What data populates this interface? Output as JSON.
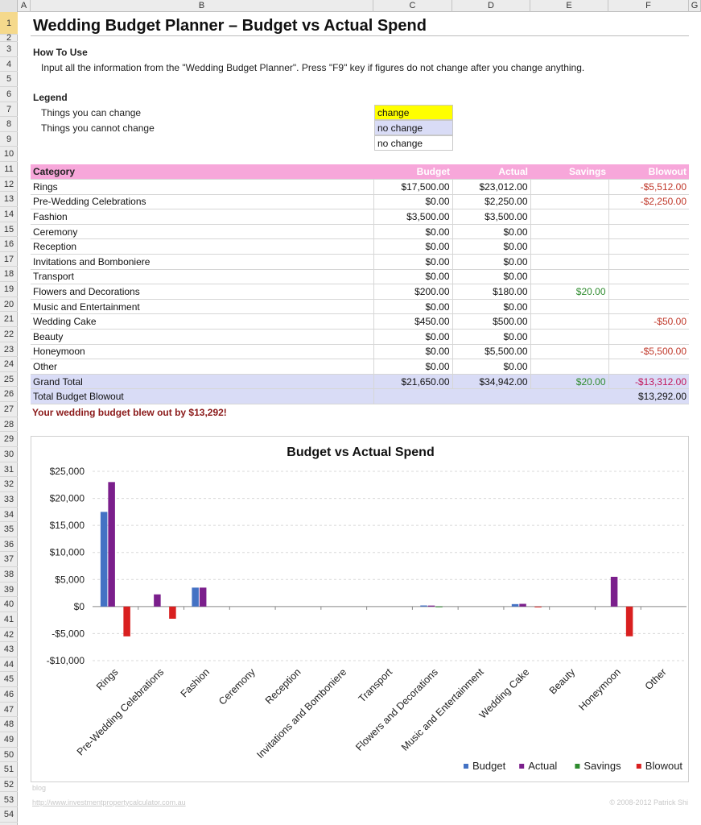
{
  "columns": [
    "A",
    "B",
    "C",
    "D",
    "E",
    "F",
    "G"
  ],
  "rows": [
    "1",
    "2",
    "3",
    "4",
    "5",
    "6",
    "7",
    "8",
    "9",
    "10",
    "11",
    "12",
    "13",
    "14",
    "15",
    "16",
    "17",
    "18",
    "19",
    "20",
    "21",
    "22",
    "23",
    "24",
    "25",
    "26",
    "27",
    "28",
    "29",
    "30",
    "31",
    "32",
    "33",
    "34",
    "35",
    "36",
    "37",
    "38",
    "39",
    "40",
    "41",
    "42",
    "43",
    "44",
    "45",
    "46",
    "47",
    "48",
    "49",
    "50",
    "51",
    "52",
    "53",
    "54"
  ],
  "title": "Wedding Budget Planner – Budget vs Actual Spend",
  "howto": {
    "heading": "How To Use",
    "text": "Input all the information from the \"Wedding Budget Planner\". Press \"F9\" key if figures do not change after you change anything."
  },
  "legend": {
    "heading": "Legend",
    "can_change": "Things you can change",
    "cannot_change": "Things you cannot change",
    "box1": "change",
    "box2": "no change",
    "box3": "no change",
    "colors": {
      "change": "#ffff00",
      "no_change_1": "#d9dcf6",
      "no_change_2": "#ffffff"
    }
  },
  "table": {
    "headers": [
      "Category",
      "Budget",
      "Actual",
      "Savings",
      "Blowout"
    ],
    "rows": [
      [
        "Rings",
        "$17,500.00",
        "$23,012.00",
        "",
        "-$5,512.00"
      ],
      [
        "Pre-Wedding Celebrations",
        "$0.00",
        "$2,250.00",
        "",
        "-$2,250.00"
      ],
      [
        "Fashion",
        "$3,500.00",
        "$3,500.00",
        "",
        ""
      ],
      [
        "Ceremony",
        "$0.00",
        "$0.00",
        "",
        ""
      ],
      [
        "Reception",
        "$0.00",
        "$0.00",
        "",
        ""
      ],
      [
        "Invitations and Bomboniere",
        "$0.00",
        "$0.00",
        "",
        ""
      ],
      [
        "Transport",
        "$0.00",
        "$0.00",
        "",
        ""
      ],
      [
        "Flowers and Decorations",
        "$200.00",
        "$180.00",
        "$20.00",
        ""
      ],
      [
        "Music and Entertainment",
        "$0.00",
        "$0.00",
        "",
        ""
      ],
      [
        "Wedding Cake",
        "$450.00",
        "$500.00",
        "",
        "-$50.00"
      ],
      [
        "Beauty",
        "$0.00",
        "$0.00",
        "",
        ""
      ],
      [
        "Honeymoon",
        "$0.00",
        "$5,500.00",
        "",
        "-$5,500.00"
      ],
      [
        "Other",
        "$0.00",
        "$0.00",
        "",
        ""
      ]
    ],
    "grand_total": [
      "Grand Total",
      "$21,650.00",
      "$34,942.00",
      "$20.00",
      "-$13,312.00"
    ],
    "blowout_total": [
      "Total Budget Blowout",
      "$13,292.00"
    ],
    "header_color": "#f7a7da",
    "total_color": "#d9dcf6"
  },
  "message": "Your wedding budget blew out by $13,292!",
  "chart_data": {
    "type": "bar",
    "title": "Budget vs Actual Spend",
    "categories": [
      "Rings",
      "Pre-Wedding Celebrations",
      "Fashion",
      "Ceremony",
      "Reception",
      "Invitations and Bomboniere",
      "Transport",
      "Flowers and Decorations",
      "Music and Entertainment",
      "Wedding Cake",
      "Beauty",
      "Honeymoon",
      "Other"
    ],
    "series": [
      {
        "name": "Budget",
        "color": "#4472c4",
        "values": [
          17500,
          0,
          3500,
          0,
          0,
          0,
          0,
          200,
          0,
          450,
          0,
          0,
          0
        ]
      },
      {
        "name": "Actual",
        "color": "#7b1f8c",
        "values": [
          23012,
          2250,
          3500,
          0,
          0,
          0,
          0,
          180,
          0,
          500,
          0,
          5500,
          0
        ]
      },
      {
        "name": "Savings",
        "color": "#2e8b2e",
        "values": [
          0,
          0,
          0,
          0,
          0,
          0,
          0,
          20,
          0,
          0,
          0,
          0,
          0
        ]
      },
      {
        "name": "Blowout",
        "color": "#d92020",
        "values": [
          -5512,
          -2250,
          0,
          0,
          0,
          0,
          0,
          0,
          0,
          -50,
          0,
          -5500,
          0
        ]
      }
    ],
    "ylim": [
      -10000,
      25000
    ],
    "yticks": [
      25000,
      20000,
      15000,
      10000,
      5000,
      0,
      -5000,
      -10000
    ],
    "ytick_labels": [
      "$25,000",
      "$20,000",
      "$15,000",
      "$10,000",
      "$5,000",
      "$0",
      "-$5,000",
      "-$10,000"
    ],
    "grid": true,
    "legend_position": "bottom-right"
  },
  "footer": {
    "line1": "blog",
    "line2": "http://www.investmentpropertycalculator.com.au",
    "right": "© 2008-2012 Patrick Shi"
  }
}
